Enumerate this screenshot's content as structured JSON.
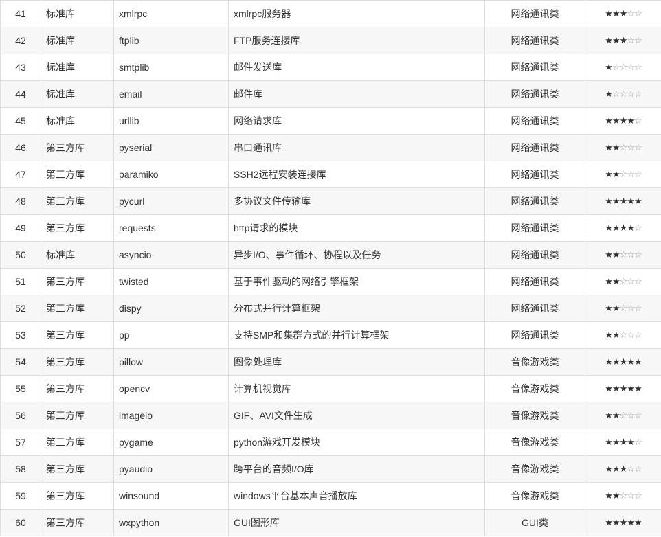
{
  "table": {
    "rows": [
      {
        "index": "41",
        "type": "标准库",
        "name": "xmlrpc",
        "description": "xmlrpc服务器",
        "category": "网络通讯类",
        "rating": 3
      },
      {
        "index": "42",
        "type": "标准库",
        "name": "ftplib",
        "description": "FTP服务连接库",
        "category": "网络通讯类",
        "rating": 3
      },
      {
        "index": "43",
        "type": "标准库",
        "name": "smtplib",
        "description": "邮件发送库",
        "category": "网络通讯类",
        "rating": 1
      },
      {
        "index": "44",
        "type": "标准库",
        "name": "email",
        "description": "邮件库",
        "category": "网络通讯类",
        "rating": 1
      },
      {
        "index": "45",
        "type": "标准库",
        "name": "urllib",
        "description": "网络请求库",
        "category": "网络通讯类",
        "rating": 4
      },
      {
        "index": "46",
        "type": "第三方库",
        "name": "pyserial",
        "description": "串口通讯库",
        "category": "网络通讯类",
        "rating": 2
      },
      {
        "index": "47",
        "type": "第三方库",
        "name": "paramiko",
        "description": "SSH2远程安装连接库",
        "category": "网络通讯类",
        "rating": 2
      },
      {
        "index": "48",
        "type": "第三方库",
        "name": "pycurl",
        "description": "多协议文件传输库",
        "category": "网络通讯类",
        "rating": 5
      },
      {
        "index": "49",
        "type": "第三方库",
        "name": "requests",
        "description": "http请求的模块",
        "category": "网络通讯类",
        "rating": 4
      },
      {
        "index": "50",
        "type": "标准库",
        "name": "asyncio",
        "description": "异步I/O、事件循环、协程以及任务",
        "category": "网络通讯类",
        "rating": 2
      },
      {
        "index": "51",
        "type": "第三方库",
        "name": "twisted",
        "description": "基于事件驱动的网络引擎框架",
        "category": "网络通讯类",
        "rating": 2
      },
      {
        "index": "52",
        "type": "第三方库",
        "name": "dispy",
        "description": "分布式并行计算框架",
        "category": "网络通讯类",
        "rating": 2
      },
      {
        "index": "53",
        "type": "第三方库",
        "name": "pp",
        "description": "支持SMP和集群方式的并行计算框架",
        "category": "网络通讯类",
        "rating": 2
      },
      {
        "index": "54",
        "type": "第三方库",
        "name": "pillow",
        "description": "图像处理库",
        "category": "音像游戏类",
        "rating": 5
      },
      {
        "index": "55",
        "type": "第三方库",
        "name": "opencv",
        "description": "计算机视觉库",
        "category": "音像游戏类",
        "rating": 5
      },
      {
        "index": "56",
        "type": "第三方库",
        "name": "imageio",
        "description": "GIF、AVI文件生成",
        "category": "音像游戏类",
        "rating": 2
      },
      {
        "index": "57",
        "type": "第三方库",
        "name": "pygame",
        "description": "python游戏开发模块",
        "category": "音像游戏类",
        "rating": 4
      },
      {
        "index": "58",
        "type": "第三方库",
        "name": "pyaudio",
        "description": "跨平台的音频I/O库",
        "category": "音像游戏类",
        "rating": 3
      },
      {
        "index": "59",
        "type": "第三方库",
        "name": "winsound",
        "description": "windows平台基本声音播放库",
        "category": "音像游戏类",
        "rating": 2
      },
      {
        "index": "60",
        "type": "第三方库",
        "name": "wxpython",
        "description": "GUI图形库",
        "category": "GUI类",
        "rating": 5
      }
    ],
    "rating_max": 5,
    "star_filled_glyph": "★",
    "star_empty_glyph": "☆"
  }
}
